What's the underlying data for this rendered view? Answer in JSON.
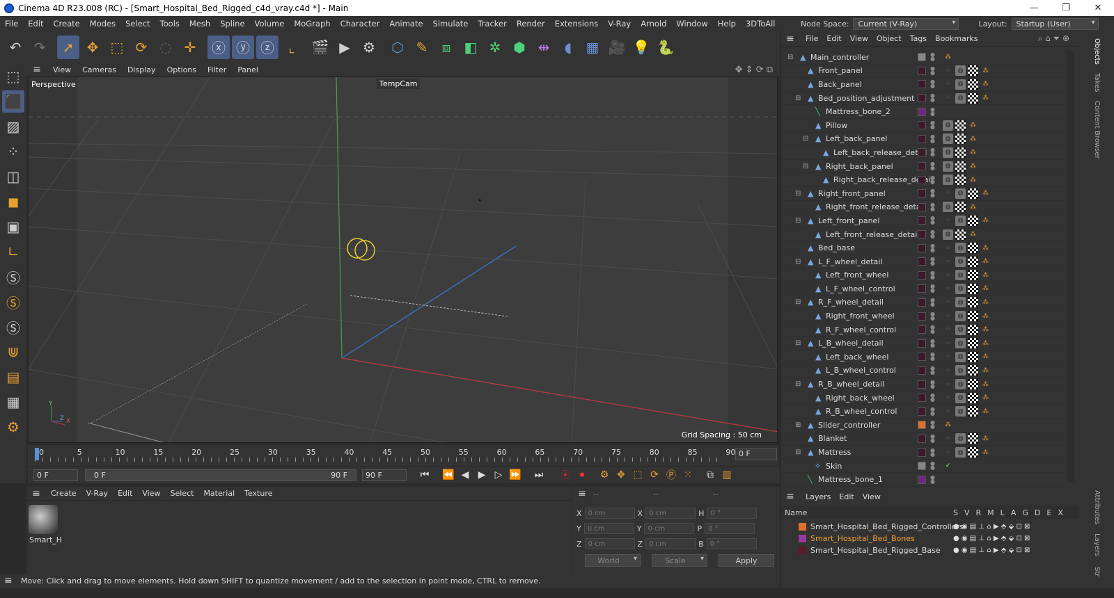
{
  "window": {
    "title": "Cinema 4D R23.008 (RC) - [Smart_Hospital_Bed_Rigged_c4d_vray.c4d *] - Main",
    "minimize": "—",
    "maximize": "❐",
    "close": "✕"
  },
  "menu": [
    "File",
    "Edit",
    "Create",
    "Modes",
    "Select",
    "Tools",
    "Mesh",
    "Spline",
    "Volume",
    "MoGraph",
    "Character",
    "Animate",
    "Simulate",
    "Tracker",
    "Render",
    "Extensions",
    "V-Ray",
    "Arnold",
    "Window",
    "Help",
    "3DToAll"
  ],
  "node_space": {
    "label": "Node Space:",
    "value": "Current (V-Ray)"
  },
  "layout": {
    "label": "Layout:",
    "value": "Startup (User)"
  },
  "viewport": {
    "menu": [
      "View",
      "Cameras",
      "Display",
      "Options",
      "Filter",
      "Panel"
    ],
    "label": "Perspective",
    "camera": "TempCam",
    "grid_spacing": "Grid Spacing : 50 cm",
    "axis_y": "Y",
    "axis_z": "Z",
    "axis_x": "X"
  },
  "timeline": {
    "ticks": [
      "0",
      "5",
      "10",
      "15",
      "20",
      "25",
      "30",
      "35",
      "40",
      "45",
      "50",
      "55",
      "60",
      "65",
      "70",
      "75",
      "80",
      "85",
      "90"
    ],
    "frame": "0 F"
  },
  "playbar": {
    "start": "0 F",
    "range_start": "0 F",
    "range_end": "90 F",
    "end": "90 F"
  },
  "material": {
    "menu": [
      "Create",
      "V-Ray",
      "Edit",
      "View",
      "Select",
      "Material",
      "Texture"
    ],
    "name": "Smart_H"
  },
  "coords": {
    "headers": [
      "--",
      "--",
      "--"
    ],
    "x": "X",
    "y": "Y",
    "z": "Z",
    "h": "H",
    "p": "P",
    "b": "B",
    "pos": "0 cm",
    "rot": "0 °",
    "world": "World",
    "scale": "Scale",
    "apply": "Apply"
  },
  "status": "Move: Click and drag to move elements. Hold down SHIFT to quantize movement / add to the selection in point mode, CTRL to remove.",
  "objects": {
    "menu": [
      "File",
      "Edit",
      "View",
      "Object",
      "Tags",
      "Bookmarks"
    ],
    "rows": [
      {
        "name": "Main_controller",
        "indent": 0,
        "exp": "⊟"
      },
      {
        "name": "Front_panel",
        "indent": 1,
        "exp": ""
      },
      {
        "name": "Back_panel",
        "indent": 1,
        "exp": ""
      },
      {
        "name": "Bed_position_adjustment",
        "indent": 1,
        "exp": "⊟"
      },
      {
        "name": "Mattress_bone_2",
        "indent": 2,
        "exp": ""
      },
      {
        "name": "Pillow",
        "indent": 2,
        "exp": ""
      },
      {
        "name": "Left_back_panel",
        "indent": 2,
        "exp": "⊟"
      },
      {
        "name": "Left_back_release_detail",
        "indent": 3,
        "exp": ""
      },
      {
        "name": "Right_back_panel",
        "indent": 2,
        "exp": "⊟"
      },
      {
        "name": "Right_back_release_detail",
        "indent": 3,
        "exp": ""
      },
      {
        "name": "Right_front_panel",
        "indent": 1,
        "exp": "⊟"
      },
      {
        "name": "Right_front_release_detail",
        "indent": 2,
        "exp": ""
      },
      {
        "name": "Left_front_panel",
        "indent": 1,
        "exp": "⊟"
      },
      {
        "name": "Left_front_release_detail",
        "indent": 2,
        "exp": ""
      },
      {
        "name": "Bed_base",
        "indent": 1,
        "exp": ""
      },
      {
        "name": "L_F_wheel_detail",
        "indent": 1,
        "exp": "⊟"
      },
      {
        "name": "Left_front_wheel",
        "indent": 2,
        "exp": ""
      },
      {
        "name": "L_F_wheel_control",
        "indent": 2,
        "exp": ""
      },
      {
        "name": "R_F_wheel_detail",
        "indent": 1,
        "exp": "⊟"
      },
      {
        "name": "Right_front_wheel",
        "indent": 2,
        "exp": ""
      },
      {
        "name": "R_F_wheel_control",
        "indent": 2,
        "exp": ""
      },
      {
        "name": "L_B_wheel_detail",
        "indent": 1,
        "exp": "⊟"
      },
      {
        "name": "Left_back_wheel",
        "indent": 2,
        "exp": ""
      },
      {
        "name": "L_B_wheel_control",
        "indent": 2,
        "exp": ""
      },
      {
        "name": "R_B_wheel_detail",
        "indent": 1,
        "exp": "⊟"
      },
      {
        "name": "Right_back_wheel",
        "indent": 2,
        "exp": ""
      },
      {
        "name": "R_B_wheel_control",
        "indent": 2,
        "exp": ""
      },
      {
        "name": "Slider_controller",
        "indent": 1,
        "exp": "⊞"
      },
      {
        "name": "Blanket",
        "indent": 1,
        "exp": ""
      },
      {
        "name": "Mattress",
        "indent": 1,
        "exp": "⊟"
      },
      {
        "name": "Skin",
        "indent": 2,
        "exp": ""
      },
      {
        "name": "Mattress_bone_1",
        "indent": 1,
        "exp": ""
      }
    ]
  },
  "layers": {
    "menu": [
      "Layers",
      "Edit",
      "View"
    ],
    "name_col": "Name",
    "cols": [
      "S",
      "V",
      "R",
      "M",
      "L",
      "A",
      "G",
      "D",
      "E",
      "X"
    ],
    "rows": [
      {
        "name": "Smart_Hospital_Bed_Rigged_Controllers",
        "color": "#e07030"
      },
      {
        "name": "Smart_Hospital_Bed_Bones",
        "color": "#9a3a9a"
      },
      {
        "name": "Smart_Hospital_Bed_Rigged_Base",
        "color": "#5a1a2a"
      }
    ]
  },
  "sidetabs": [
    "Objects",
    "Takes",
    "Content Browser",
    "Attributes",
    "Layers",
    "Str"
  ]
}
